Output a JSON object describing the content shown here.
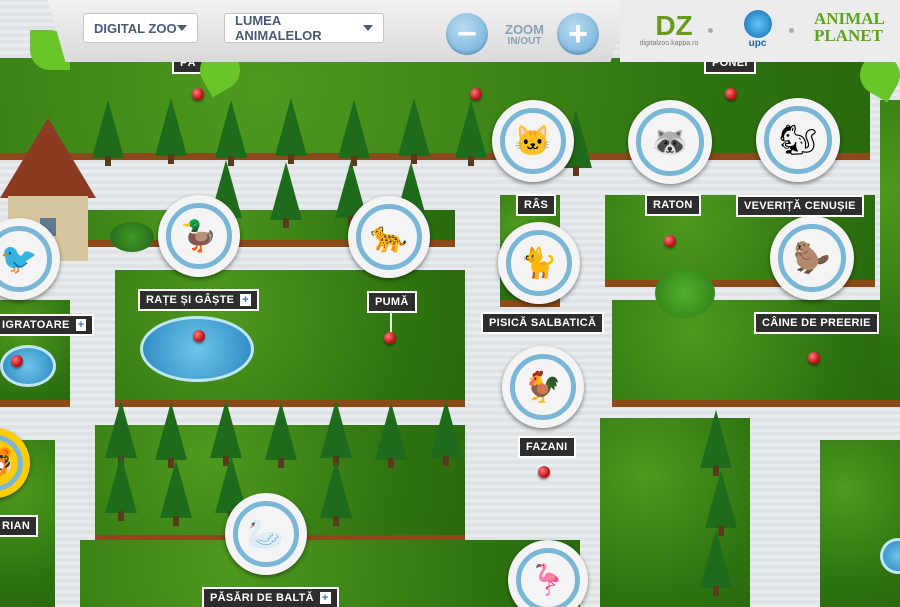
{
  "header": {
    "dropdown1": "DIGITAL ZOO",
    "dropdown2": "LUMEA ANIMALELOR",
    "zoom_label": "ZOOM",
    "zoom_sub": "IN/OUT",
    "zoom_minus": "−",
    "zoom_plus": "+",
    "logo_dz": "DZ",
    "logo_dz_sub": "digitalzoo.kappa.ro",
    "logo_upc": "upc",
    "logo_ap": "ANIMAL PLANET"
  },
  "labels": {
    "pa": "PĂ",
    "ponei": "PONEI",
    "ras": "RÂS",
    "raton": "RATON",
    "veverita": "VEVERIȚĂ CENUȘIE",
    "rate": "RAȚE ȘI GÂȘTE",
    "puma": "PUMĂ",
    "pisica": "PISICĂ SALBATICĂ",
    "caine": "CÂINE DE PREERIE",
    "migratoare": "IGRATOARE",
    "fazani": "FAZANI",
    "rian": "RIAN",
    "pasari": "PĂSĂRI DE BALTĂ"
  },
  "plus_sign": "+",
  "icons": {
    "ras": "🐱",
    "raton": "🦝",
    "veverita": "🐿",
    "rate": "🦆",
    "puma": "🐆",
    "pisica": "🐈",
    "caine": "🦫",
    "migratoare": "🐦",
    "fazani": "🐓",
    "tigru": "🐯",
    "lebada": "🦢",
    "flamingo": "🦩"
  },
  "colors": {
    "accent": "#7ab6d6",
    "pin": "#c0141a",
    "label_bg": "#2d2d2d"
  }
}
